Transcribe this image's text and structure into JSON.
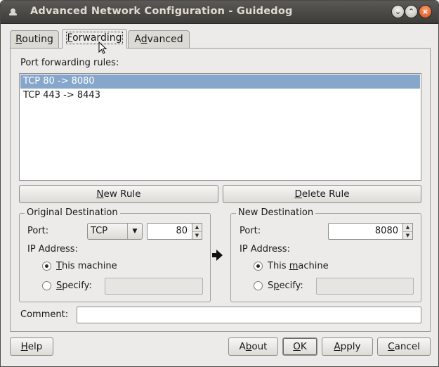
{
  "window": {
    "title": "Advanced Network Configuration - Guidedog"
  },
  "tabs": [
    {
      "label": "Routing",
      "mnemonic": "R",
      "rest": "outing"
    },
    {
      "label": "Forwarding",
      "mnemonic": "F",
      "rest": "orwarding"
    },
    {
      "label": "Advanced",
      "pre": "A",
      "mnemonic": "d",
      "rest": "vanced"
    }
  ],
  "forwarding": {
    "rules_label": "Port forwarding rules:",
    "rules": [
      "TCP 80 -> 8080",
      "TCP 443 -> 8443"
    ],
    "selected_rule_index": 0,
    "new_rule": {
      "mnemonic": "N",
      "rest": "ew Rule",
      "label": "New Rule"
    },
    "delete_rule": {
      "mnemonic": "D",
      "rest": "elete Rule",
      "label": "Delete Rule"
    },
    "original": {
      "title": "Original Destination",
      "port_label": "Port:",
      "protocol": "TCP",
      "port_value": "80",
      "ip_label": "IP Address:",
      "this_machine": {
        "mnemonic": "T",
        "rest": "his machine",
        "label": "This machine",
        "selected": true
      },
      "specify": {
        "mnemonic": "S",
        "rest": "pecify:",
        "label": "Specify:",
        "selected": false,
        "value": ""
      }
    },
    "new": {
      "title": "New Destination",
      "port_label": "Port:",
      "port_value": "8080",
      "ip_label": "IP Address:",
      "this_machine": {
        "pre": "This ",
        "mnemonic": "m",
        "rest": "achine",
        "label": "This machine",
        "selected": true
      },
      "specify": {
        "pre": "S",
        "mnemonic": "p",
        "rest": "ecify:",
        "label": "Specify:",
        "selected": false,
        "value": ""
      }
    },
    "comment_label": "Comment:",
    "comment_value": ""
  },
  "footer": {
    "help": {
      "mnemonic": "H",
      "rest": "elp",
      "label": "Help"
    },
    "about": {
      "pre": "A",
      "mnemonic": "b",
      "rest": "out",
      "label": "About"
    },
    "ok": {
      "mnemonic": "O",
      "rest": "K",
      "label": "OK"
    },
    "apply": {
      "mnemonic": "A",
      "rest": "pply",
      "label": "Apply"
    },
    "cancel": {
      "mnemonic": "C",
      "rest": "ancel",
      "label": "Cancel"
    }
  },
  "colors": {
    "selection": "#86a7cb",
    "titlebar": "#3d3c38",
    "close_button": "#d94c14"
  },
  "icons": [
    "window-menu-icon",
    "minimize-icon",
    "maximize-icon",
    "close-icon",
    "right-arrow-icon",
    "mouse-cursor-icon",
    "chevron-down-icon",
    "spin-up-icon",
    "spin-down-icon"
  ]
}
